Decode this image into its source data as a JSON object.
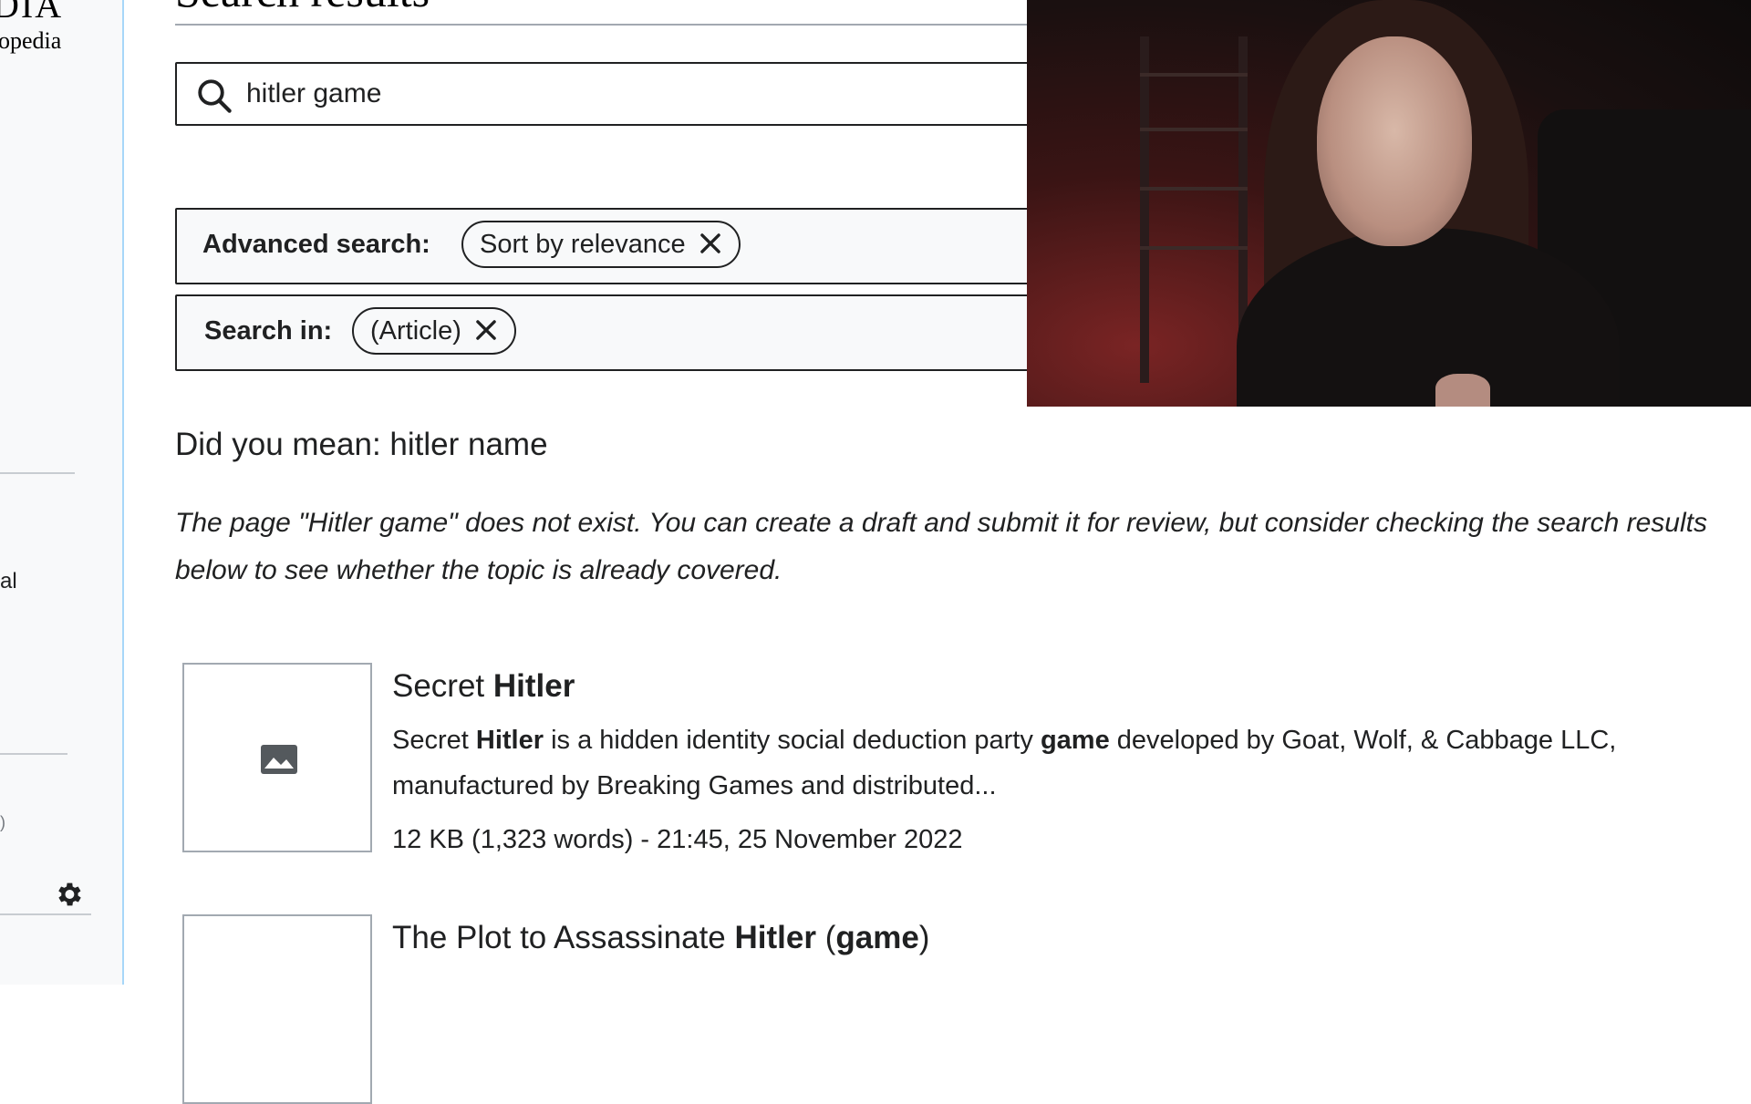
{
  "sidebar": {
    "logo_text": "DIA",
    "logo_subtitle": "opedia",
    "fragment_1": "al",
    "fragment_2": ")",
    "settings_icon": "gear-icon"
  },
  "page": {
    "heading": "Search results"
  },
  "search": {
    "icon": "search-icon",
    "value": "hitler game"
  },
  "advanced_search": {
    "label": "Advanced search:",
    "chip_label": "Sort by relevance"
  },
  "search_in": {
    "label": "Search in:",
    "chip_label": "(Article)"
  },
  "did_you_mean": {
    "prefix": "Did you mean:",
    "suggestion": "hitler name"
  },
  "notice": {
    "text": "The page \"Hitler game\" does not exist. You can create a draft and submit it for review, but consider checking the search results below to see whether the topic is already covered."
  },
  "results": [
    {
      "title_plain": "Secret",
      "title_bold": "Hitler",
      "snippet_1": "Secret",
      "snippet_2": "Hitler",
      "snippet_3": "is a hidden identity social deduction party",
      "snippet_4": "game",
      "snippet_5": "developed by Goat, Wolf, & Cabbage LLC, manufactured by Breaking Games and distributed...",
      "meta": "12 KB (1,323 words) - 21:45, 25 November 2022",
      "thumbnail_icon": "image-placeholder-icon"
    },
    {
      "title_plain": "The Plot to Assassinate",
      "title_bold": "Hitler",
      "title_open": "(",
      "title_bold_2": "game",
      "title_close": ")"
    }
  ],
  "colors": {
    "sidebar_bg": "#f8f9fa",
    "sidebar_border": "#a7d7f9",
    "text": "#202122",
    "border": "#a2a9b1"
  }
}
